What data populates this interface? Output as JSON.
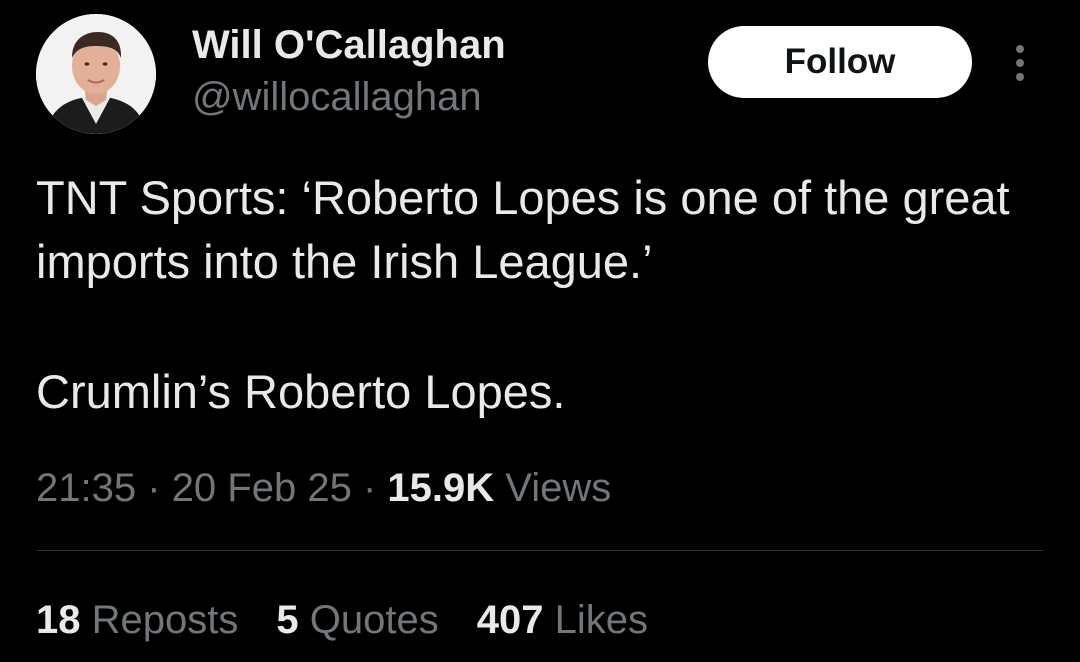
{
  "author": {
    "display_name": "Will O'Callaghan",
    "handle": "@willocallaghan",
    "avatar_icon": "profile-photo"
  },
  "actions": {
    "follow_label": "Follow",
    "more_icon": "vertical-ellipsis-icon"
  },
  "tweet": {
    "line1": "TNT Sports: ‘Roberto Lopes is one of the great imports into the Irish League.’",
    "line2": "Crumlin’s Roberto Lopes."
  },
  "meta": {
    "time": "21:35",
    "separator": "·",
    "date": "20 Feb 25",
    "views_count": "15.9K",
    "views_label": "Views"
  },
  "stats": {
    "reposts_count": "18",
    "reposts_label": "Reposts",
    "quotes_count": "5",
    "quotes_label": "Quotes",
    "likes_count": "407",
    "likes_label": "Likes"
  },
  "colors": {
    "background": "#000000",
    "primary_text": "#e7e9ea",
    "secondary_text": "#71767b",
    "follow_button_bg": "#ffffff",
    "divider": "#2f3336"
  }
}
